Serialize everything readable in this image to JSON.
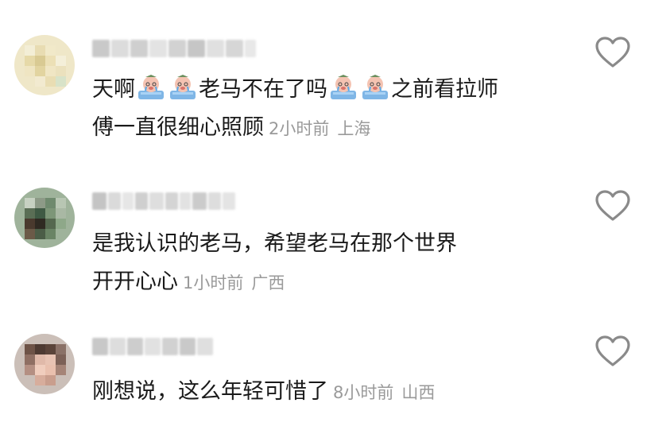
{
  "comments": [
    {
      "text_line1": "天啊",
      "text_line1_b": "老马不在了吗",
      "text_line1_c": "之前看拉师",
      "text_line2": "傅一直很细心照顾",
      "time": "2小时前",
      "location": "上海",
      "emoji_icon": "crying-baby-emoji"
    },
    {
      "text_line1": "是我认识的老马，希望老马在那个世界",
      "text_line2": "开开心心",
      "time": "1小时前",
      "location": "广西"
    },
    {
      "text_line1": "刚想说，这么年轻可惜了",
      "time": "8小时前",
      "location": "山西"
    }
  ],
  "icons": {
    "like": "heart-outline-icon"
  },
  "colors": {
    "text": "#1a1a1a",
    "meta": "#9a9a9a",
    "icon": "#8a8a8a"
  }
}
